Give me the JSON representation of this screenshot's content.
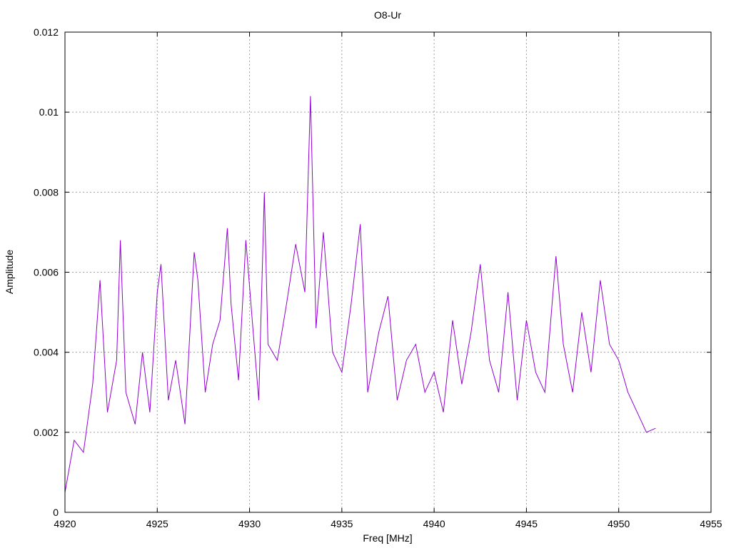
{
  "chart_data": {
    "type": "line",
    "title": "O8-Ur",
    "xlabel": "Freq [MHz]",
    "ylabel": "Amplitude",
    "xlim": [
      4920,
      4955
    ],
    "ylim": [
      0,
      0.012
    ],
    "xticks": [
      4920,
      4925,
      4930,
      4935,
      4940,
      4945,
      4950,
      4955
    ],
    "yticks": [
      "0",
      "0.002",
      "0.004",
      "0.006",
      "0.008",
      "0.01",
      "0.012"
    ],
    "grid": true,
    "line_color": "#9400d3",
    "series": [
      {
        "x": [
          4920.0,
          4920.5,
          4921.0,
          4921.5,
          4921.7,
          4921.9,
          4922.3,
          4922.8,
          4923.0,
          4923.3,
          4923.8,
          4924.2,
          4924.6,
          4925.0,
          4925.2,
          4925.6,
          4926.0,
          4926.5,
          4927.0,
          4927.2,
          4927.6,
          4928.0,
          4928.4,
          4928.8,
          4929.0,
          4929.4,
          4929.8,
          4930.2,
          4930.5,
          4930.8,
          4931.0,
          4931.5,
          4932.0,
          4932.5,
          4933.0,
          4933.3,
          4933.6,
          4934.0,
          4934.5,
          4935.0,
          4935.5,
          4936.0,
          4936.4,
          4937.0,
          4937.5,
          4938.0,
          4938.5,
          4939.0,
          4939.5,
          4940.0,
          4940.5,
          4941.0,
          4941.5,
          4942.0,
          4942.5,
          4943.0,
          4943.5,
          4944.0,
          4944.5,
          4945.0,
          4945.5,
          4946.0,
          4946.6,
          4947.0,
          4947.5,
          4948.0,
          4948.5,
          4949.0,
          4949.5,
          4950.0,
          4950.5,
          4951.0,
          4951.5,
          4952.0
        ],
        "values": [
          0.0005,
          0.0018,
          0.0015,
          0.0032,
          0.0045,
          0.0058,
          0.0025,
          0.0038,
          0.0068,
          0.003,
          0.0022,
          0.004,
          0.0025,
          0.0055,
          0.0062,
          0.0028,
          0.0038,
          0.0022,
          0.0065,
          0.0058,
          0.003,
          0.0042,
          0.0048,
          0.0071,
          0.0052,
          0.0033,
          0.0068,
          0.0045,
          0.0028,
          0.008,
          0.0042,
          0.0038,
          0.0052,
          0.0067,
          0.0055,
          0.0104,
          0.0046,
          0.007,
          0.004,
          0.0035,
          0.0052,
          0.0072,
          0.003,
          0.0045,
          0.0054,
          0.0028,
          0.0038,
          0.0042,
          0.003,
          0.0035,
          0.0025,
          0.0048,
          0.0032,
          0.0045,
          0.0062,
          0.0038,
          0.003,
          0.0055,
          0.0028,
          0.0048,
          0.0035,
          0.003,
          0.0064,
          0.0042,
          0.003,
          0.005,
          0.0035,
          0.0058,
          0.0042,
          0.0038,
          0.003,
          0.0025,
          0.002,
          0.0021
        ]
      }
    ]
  }
}
